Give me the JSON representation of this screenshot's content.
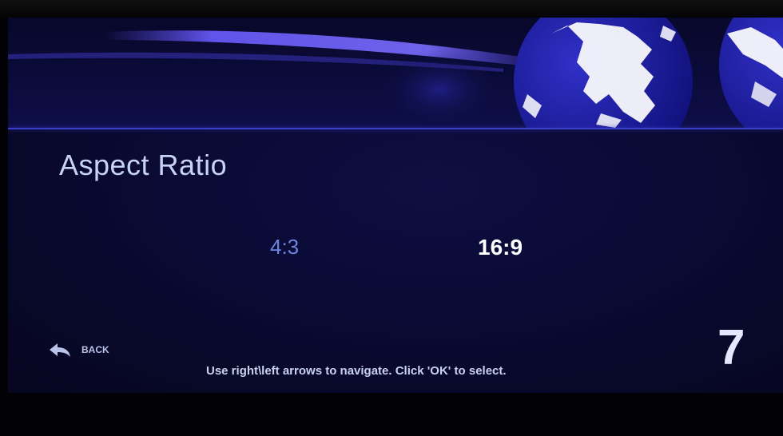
{
  "screen": {
    "title": "Aspect Ratio",
    "options": [
      {
        "label": "4:3",
        "selected": false
      },
      {
        "label": "16:9",
        "selected": true
      }
    ],
    "back_label": "BACK",
    "hint": "Use right\\left arrows to navigate. Click 'OK' to select.",
    "page_number": "7"
  },
  "icons": {
    "back": "back-arrow-icon",
    "banner": "globe-icon"
  },
  "colors": {
    "background": "#0a0a34",
    "accent": "#3c3ec8",
    "title_text": "#c7d3f4",
    "unselected_option": "#6f84dd",
    "selected_option": "#ffffff"
  }
}
